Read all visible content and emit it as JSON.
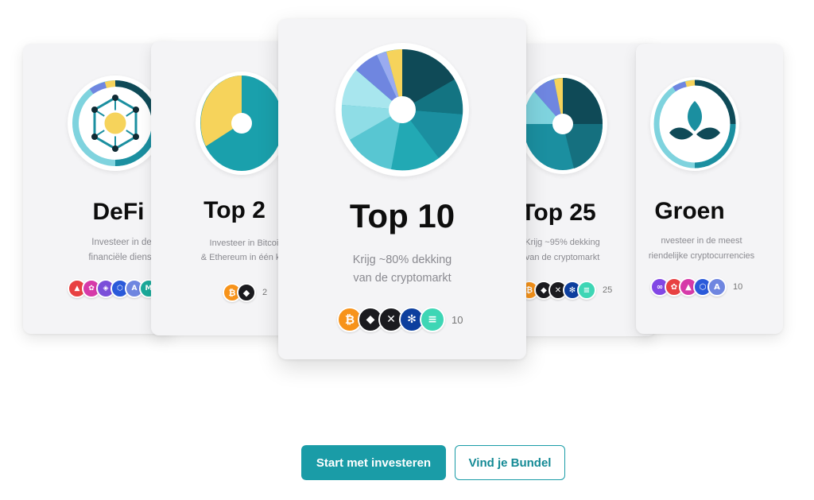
{
  "cards": {
    "defi": {
      "title": "DeFi",
      "desc_line1": "Investeer in decentra",
      "desc_line2": "financiële diensten",
      "count": ""
    },
    "top2": {
      "title": "Top 2",
      "desc_line1": "Investeer in Bitcoin",
      "desc_line2": "& Ethereum in één kli",
      "count": "2"
    },
    "top10": {
      "title": "Top 10",
      "desc_line1": "Krijg ~80% dekking",
      "desc_line2": "van de cryptomarkt",
      "count": "10"
    },
    "top25": {
      "title": "Top 25",
      "desc_line1": "Krijg ~95% dekking",
      "desc_line2": "van de cryptomarkt",
      "count": "25"
    },
    "groen": {
      "title": "Groen",
      "desc_line1": "nvesteer in de meest",
      "desc_line2": "riendelijke cryptocurrencies",
      "count": "10"
    }
  },
  "buttons": {
    "start": "Start met investeren",
    "bundel": "Vind je Bundel"
  },
  "coin_icons": {
    "bitcoin": "bitcoin-icon",
    "ethereum": "ethereum-icon",
    "xrp": "xrp-icon",
    "cardano": "cardano-icon",
    "solana": "solana-icon"
  },
  "colors": {
    "accent": "#1a9ca7",
    "teal_dark": "#0f4a57",
    "teal_mid": "#1b8fa0",
    "teal_light": "#7fd3de",
    "yellow": "#f6d35b",
    "blue": "#6f86e0"
  }
}
